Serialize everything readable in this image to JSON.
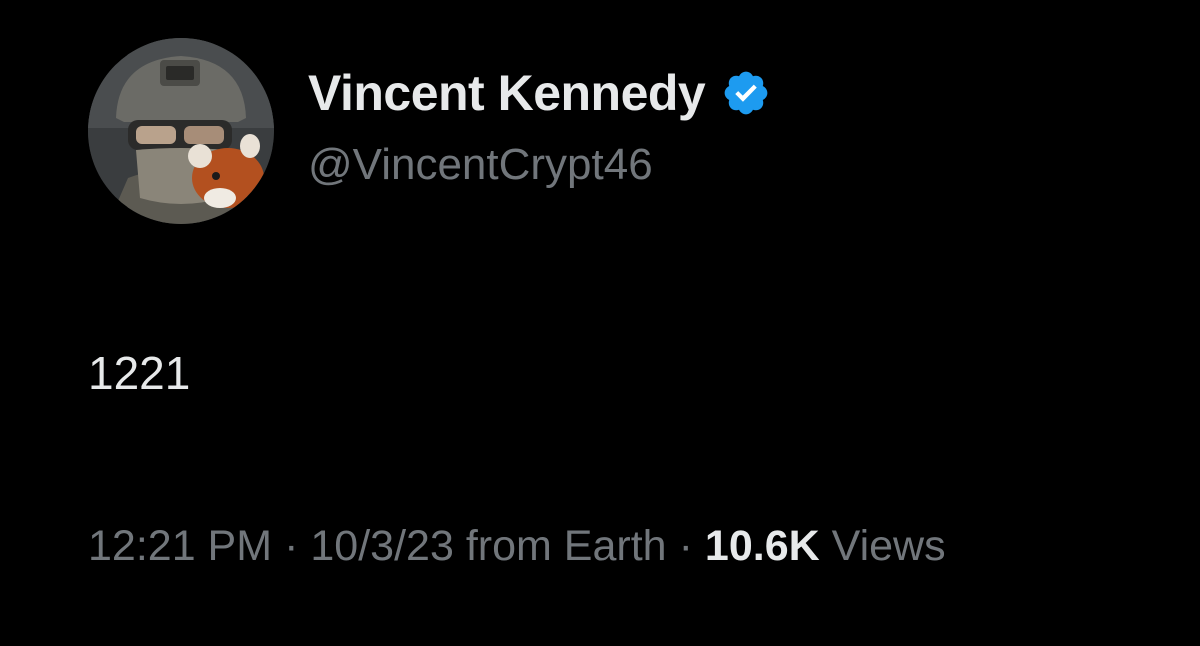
{
  "tweet": {
    "author": {
      "display_name": "Vincent Kennedy",
      "handle": "@VincentCrypt46",
      "verified": true,
      "badge_color": "#1d9bf0"
    },
    "text": "1221",
    "time": "12:21 PM",
    "date": "10/3/23",
    "source": "from Earth",
    "separator": "·",
    "views_count": "10.6K",
    "views_label": "Views"
  },
  "colors": {
    "background": "#000000",
    "primary_text": "#e7e9ea",
    "secondary_text": "#71767b"
  }
}
